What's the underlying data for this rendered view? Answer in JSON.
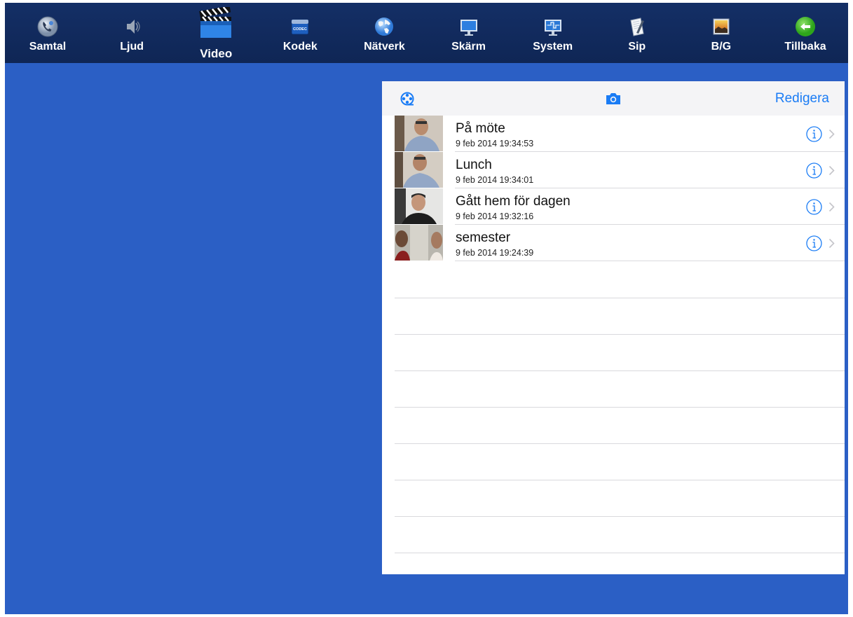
{
  "toolbar": {
    "items": [
      {
        "label": "Samtal",
        "icon": "phone-settings-icon"
      },
      {
        "label": "Ljud",
        "icon": "speaker-icon"
      },
      {
        "label": "Video",
        "icon": "clapperboard-icon",
        "active": true
      },
      {
        "label": "Kodek",
        "icon": "codec-icon",
        "icon_text": "CODEC"
      },
      {
        "label": "Nätverk",
        "icon": "globe-icon"
      },
      {
        "label": "Skärm",
        "icon": "monitor-icon"
      },
      {
        "label": "System",
        "icon": "system-monitor-icon"
      },
      {
        "label": "Sip",
        "icon": "notepad-icon"
      },
      {
        "label": "B/G",
        "icon": "picture-icon"
      },
      {
        "label": "Tillbaka",
        "icon": "back-arrow-icon"
      }
    ]
  },
  "panel": {
    "edit_label": "Redigera",
    "reel_icon": "film-reel-icon",
    "camera_icon": "camera-icon",
    "videos": [
      {
        "title": "På möte",
        "date": "9 feb 2014 19:34:53"
      },
      {
        "title": "Lunch",
        "date": "9 feb 2014 19:34:01"
      },
      {
        "title": "Gått hem för dagen",
        "date": "9 feb 2014 19:32:16"
      },
      {
        "title": "semester",
        "date": "9 feb 2014 19:24:39"
      }
    ]
  },
  "colors": {
    "background": "#2b5fc5",
    "toolbar": "#132d62",
    "accent": "#1a7cf5"
  }
}
